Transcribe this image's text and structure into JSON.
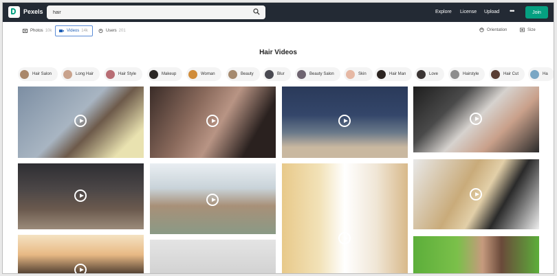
{
  "brand": "Pexels",
  "search": {
    "value": "hair"
  },
  "nav": {
    "explore": "Explore",
    "license": "License",
    "upload": "Upload",
    "more": "•••",
    "join": "Join"
  },
  "tabs": [
    {
      "label": "Photos",
      "count": "10k"
    },
    {
      "label": "Videos",
      "count": "14k"
    },
    {
      "label": "Users",
      "count": "201"
    }
  ],
  "filters": {
    "orientation": "Orientation",
    "size": "Size"
  },
  "heading": "Hair Videos",
  "chips": [
    "Hair Salon",
    "Long Hair",
    "Hair Style",
    "Makeup",
    "Woman",
    "Beauty",
    "Blur",
    "Beauty Salon",
    "Skin",
    "Hair Man",
    "Love",
    "Hairstyle",
    "Hair Cut",
    "Ha"
  ],
  "colors": {
    "topbar": "#232a34",
    "accent": "#05a081",
    "active_tab": "#1f5fb6"
  }
}
